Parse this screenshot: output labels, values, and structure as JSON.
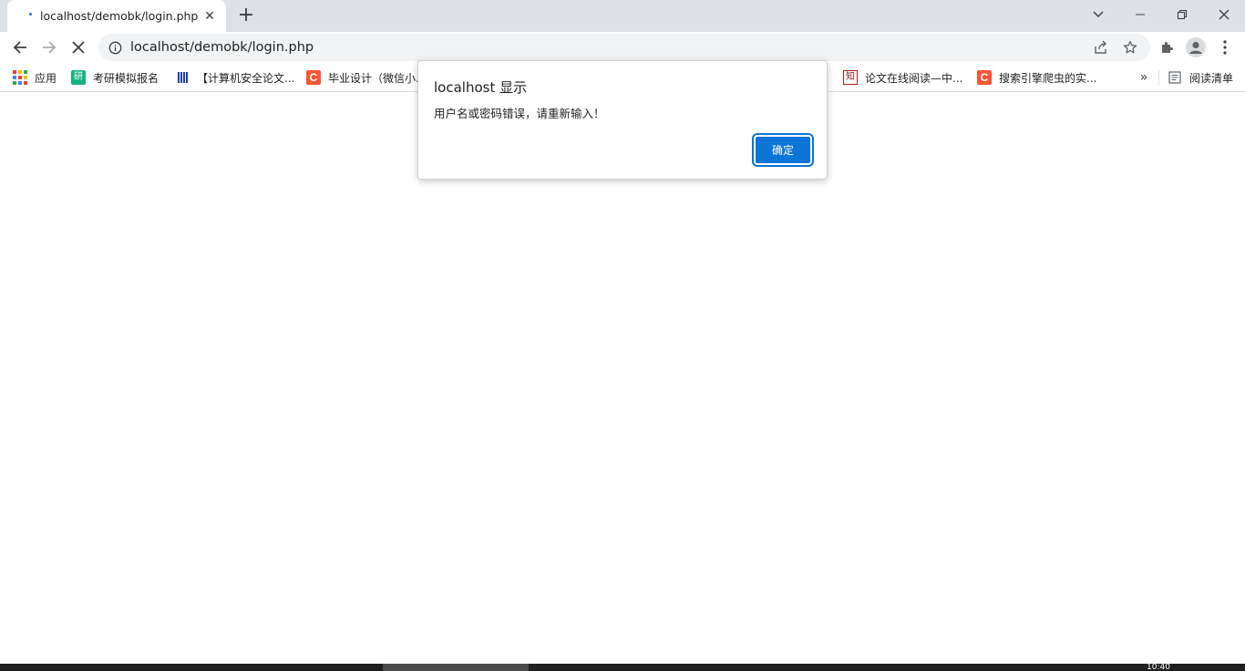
{
  "tab": {
    "title": "localhost/demobk/login.php",
    "close_glyph": "✕"
  },
  "newtab_glyph": "+",
  "address": {
    "url": "localhost/demobk/login.php"
  },
  "bookmarks": {
    "items": [
      {
        "label": "应用",
        "icon": "apps-grid-icon"
      },
      {
        "label": "考研模拟报名",
        "icon": "yan-icon",
        "glyph": "研"
      },
      {
        "label": "【计算机安全论文...",
        "icon": "library-bars-icon"
      },
      {
        "label": "毕业设计（微信小...",
        "icon": "csdn-icon",
        "glyph": "C"
      },
      {
        "label": "论文在线阅读—中...",
        "icon": "zhi-icon",
        "glyph": "知"
      },
      {
        "label": "搜索引擎爬虫的实...",
        "icon": "csdn-icon",
        "glyph": "C"
      }
    ],
    "more_glyph": "»",
    "reading_list": "阅读清单"
  },
  "dialog": {
    "title": "localhost 显示",
    "message": "用户名或密码错误，请重新输入！",
    "ok_label": "确定"
  },
  "taskbar": {
    "clock": "10:40"
  },
  "colors": {
    "tabstrip": "#dee1e6",
    "omnibox": "#f1f3f4",
    "accent": "#0b75d9",
    "csdn": "#fc5531",
    "yan": "#19b382"
  }
}
